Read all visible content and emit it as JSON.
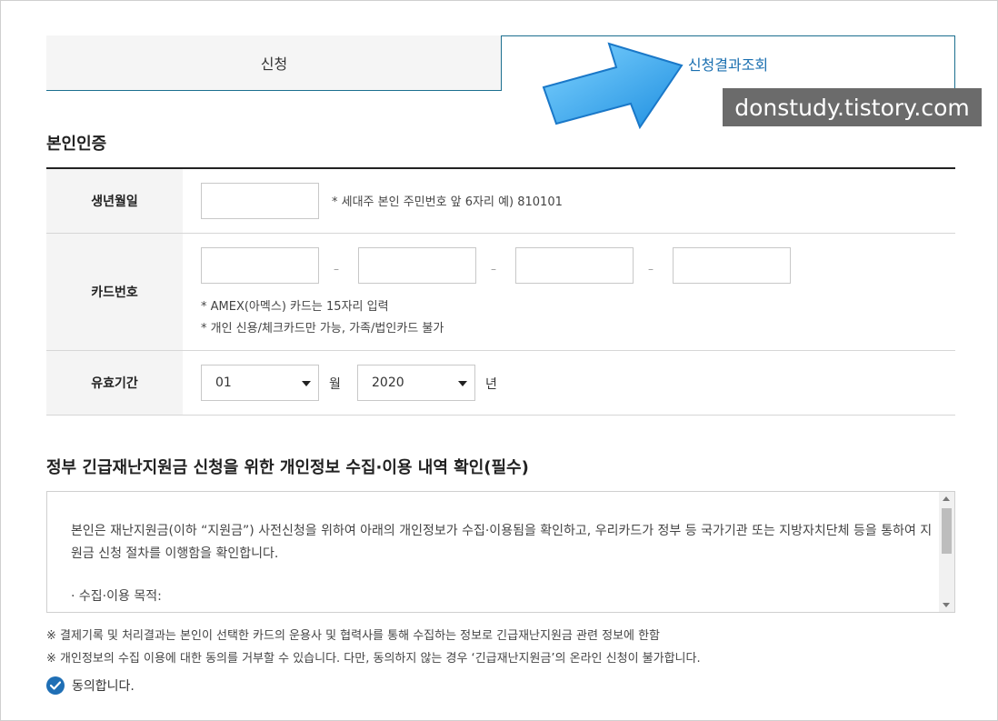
{
  "tabs": {
    "apply_label": "신청",
    "result_label": "신청결과조회"
  },
  "watermark": "donstudy.tistory.com",
  "auth": {
    "title": "본인인증",
    "birth": {
      "label": "생년월일",
      "value": "",
      "hint": "* 세대주 본인 주민번호 앞 6자리 예) 810101"
    },
    "card": {
      "label": "카드번호",
      "values": [
        "",
        "",
        "",
        ""
      ],
      "separator": "–",
      "hint1": "* AMEX(아멕스) 카드는 15자리 입력",
      "hint2": "* 개인 신용/체크카드만 가능, 가족/법인카드 불가"
    },
    "expiry": {
      "label": "유효기간",
      "month": "01",
      "month_unit": "월",
      "year": "2020",
      "year_unit": "년"
    }
  },
  "privacy": {
    "title": "정부 긴급재난지원금 신청을 위한 개인정보 수집·이용 내역 확인(필수)",
    "body": "본인은 재난지원금(이하 “지원금”) 사전신청을 위하여 아래의 개인정보가 수집·이용됨을 확인하고, 우리카드가 정부 등 국가기관 또는 지방자치단체 등을 통하여 지원금 신청 절차를 이행함을 확인합니다.",
    "bullet": "· 수집·이용 목적:"
  },
  "notes": {
    "note1": "※ 결제기록 및 처리결과는 본인이 선택한 카드의 운용사 및 협력사를 통해 수집하는 정보로 긴급재난지원금 관련 정보에 한함",
    "note2": "※ 개인정보의 수집 이용에 대한 동의를 거부할 수 있습니다. 다만, 동의하지 않는 경우 ‘긴급재난지원금’의 온라인 신청이 불가합니다."
  },
  "agree": {
    "label": "동의합니다.",
    "checked": true
  },
  "colors": {
    "accent": "#1a6fb0",
    "tab_border": "#1c6f8f",
    "arrow": "#3aa7f0",
    "check": "#1f6fb5"
  }
}
